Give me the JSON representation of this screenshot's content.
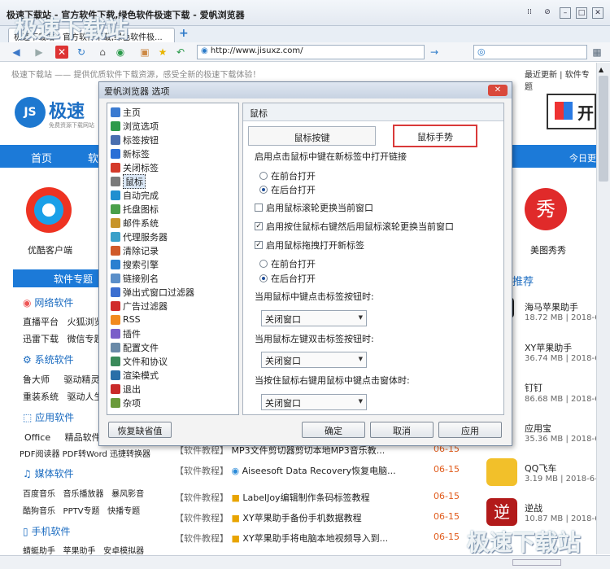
{
  "browser": {
    "window_title": "极速下载站 - 官方软件下载,绿色软件极速下载 - 爱帆浏览器",
    "tabs": [
      "极速下载站 - 官方软件下载,绿色软件极...",
      "+"
    ],
    "address": "http://www.jisuxz.com/",
    "status_url": ""
  },
  "page": {
    "topline_left": "极速下载站 —— 提供优质软件下载资源，感受全新的极速下载体验！",
    "topline_right": "最近更新 | 软件专题",
    "logo_text": "极速",
    "logo_sub": "免费资源下载网站",
    "nav": [
      "首页",
      "软",
      "今日更"
    ],
    "top_apps": [
      {
        "label": "优酷客户端"
      },
      {
        "label": "美图秀秀"
      }
    ],
    "sec_head": "软件专题",
    "recommend": "推荐",
    "categories": [
      {
        "title": "网络软件",
        "items": [
          [
            "直播平台",
            "火狐浏览"
          ],
          [
            "迅雷下载",
            "微信专题"
          ]
        ]
      },
      {
        "title": "系统软件",
        "items": [
          [
            "鲁大师",
            "驱动精灵"
          ],
          [
            "重装系统",
            "驱动人生"
          ]
        ]
      },
      {
        "title": "应用软件",
        "items": [
          [
            "Office",
            "精品软件"
          ],
          [
            "PDF阅读器",
            "PDF转Word",
            "迅捷转换器"
          ]
        ]
      },
      {
        "title": "媒体软件",
        "items": [
          [
            "百度音乐",
            "音乐播放器",
            "暴风影音"
          ],
          [
            "酷狗音乐",
            "PPTV专题",
            "快播专题"
          ]
        ]
      },
      {
        "title": "手机软件",
        "items": [
          [
            "蜻蜓助手",
            "苹果助手",
            "安卓模拟器"
          ]
        ]
      }
    ],
    "articles": [
      {
        "tag": "【软件教程】",
        "title": "MP3文件剪切器剪切本地MP3音乐教...",
        "date": "06-15"
      },
      {
        "tag": "【软件教程】",
        "title": "Aiseesoft Data Recovery恢复电脑...",
        "date": "06-15"
      },
      {
        "tag": "【软件教程】",
        "title": "LabelJoy编辑制作条码标签教程",
        "date": "06-15"
      },
      {
        "tag": "【软件教程】",
        "title": "XY苹果助手备份手机数据教程",
        "date": "06-15"
      },
      {
        "tag": "【软件教程】",
        "title": "XY苹果助手将电脑本地视频导入到...",
        "date": "06-15"
      }
    ],
    "right_apps": [
      {
        "name": "海马苹果助手",
        "meta": "18.72 MB | 2018-6"
      },
      {
        "name": "XY苹果助手",
        "meta": "36.74 MB | 2018-6"
      },
      {
        "name": "钉钉",
        "meta": "86.68 MB | 2018-6"
      },
      {
        "name": "应用宝",
        "meta": "35.36 MB | 2018-6"
      },
      {
        "name": "QQ飞车",
        "meta": "3.19 MB | 2018-6-"
      },
      {
        "name": "逆战",
        "meta": "10.87 MB | 2018-6"
      }
    ],
    "watermark": "极速下载站"
  },
  "dialog": {
    "title": "爱帆浏览器 选项",
    "close": "✕",
    "tree": [
      "主页",
      "浏览选项",
      "标签按钮",
      "新标签",
      "关闭标签",
      "鼠标",
      "自动完成",
      "托盘图标",
      "邮件系统",
      "代理服务器",
      "清除记录",
      "搜索引擎",
      "链接别名",
      "弹出式窗口过滤器",
      "广告过滤器",
      "RSS",
      "插件",
      "配置文件",
      "文件和协议",
      "渲染模式",
      "退出",
      "杂项"
    ],
    "tree_colors": [
      "#3b7bd1",
      "#2d9a4a",
      "#4a6fb0",
      "#2b6fd6",
      "#d43a2a",
      "#7a7a7a",
      "#1f8fd0",
      "#4aa04a",
      "#c7952a",
      "#3aa0c9",
      "#d05a2a",
      "#2a7fd0",
      "#5b8fc9",
      "#3c6fd0",
      "#d02a2a",
      "#f28a1e",
      "#7a5fc9",
      "#6a8aa8",
      "#3a8a5a",
      "#2a6fa8",
      "#c92a2a",
      "#6a9a3a"
    ],
    "selected": 5,
    "panel_title": "鼠标",
    "tabs": [
      "鼠标按键",
      "鼠标手势"
    ],
    "options": {
      "label1": "启用点击鼠标中键在新标签中打开链接",
      "r1a": "在前台打开",
      "r1b": "在后台打开",
      "c1": "启用鼠标滚轮更换当前窗口",
      "c2": "启用按住鼠标右键然后用鼠标滚轮更换当前窗口",
      "c3": "启用鼠标拖拽打开新标签",
      "r2a": "在前台打开",
      "r2b": "在后台打开",
      "label2": "当用鼠标中键点击标签按钮时:",
      "dd1": "关闭窗口",
      "label3": "当用鼠标左键双击标签按钮时:",
      "dd2": "关闭窗口",
      "label4": "当按住鼠标右键用鼠标中键点击窗体时:",
      "dd3": "关闭窗口"
    },
    "buttons": {
      "restore": "恢复缺省值",
      "ok": "确定",
      "cancel": "取消",
      "apply": "应用"
    }
  }
}
